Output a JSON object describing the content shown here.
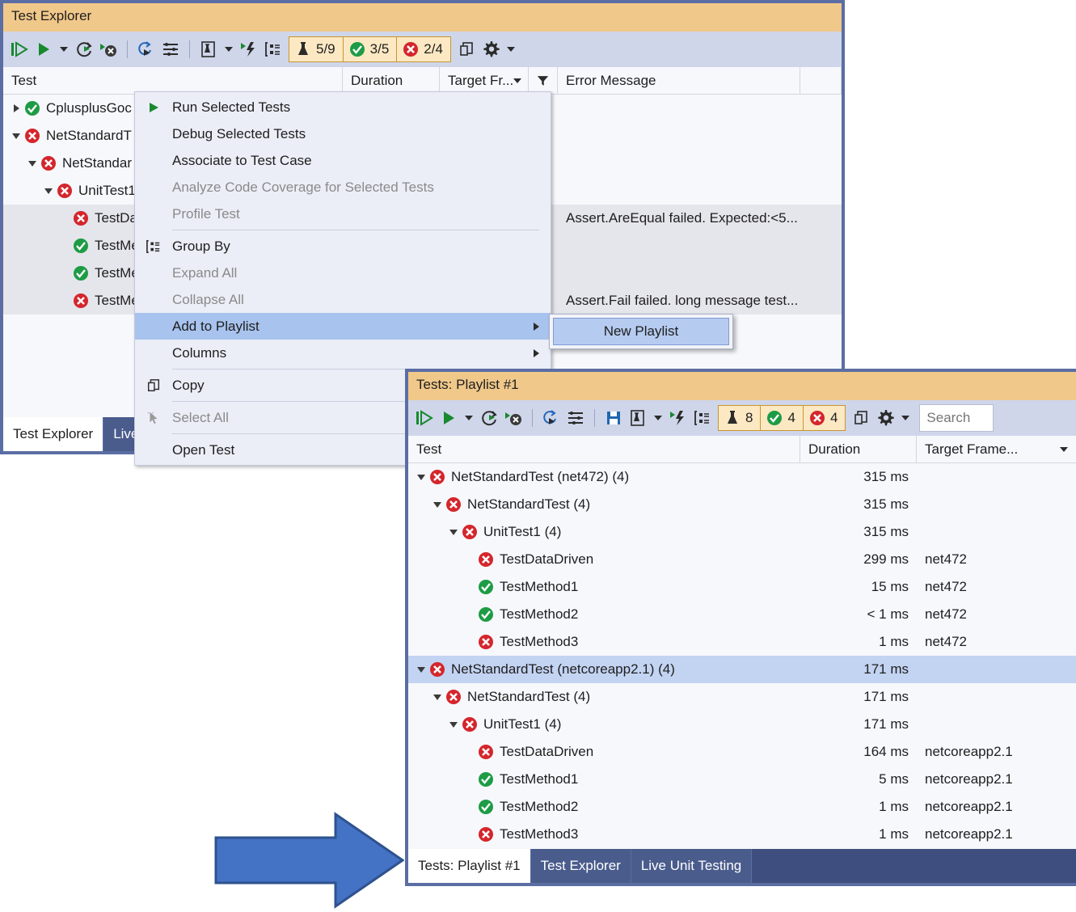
{
  "colors": {
    "window_border": "#5B6EA3",
    "title_bar": "#F0C88A",
    "toolbar": "#CFD6EA",
    "chip_bg": "#FCE8C3",
    "chip_border": "#C9962F",
    "menu_highlight": "#A8C3EE",
    "row_selected_gray": "#E5E5EC",
    "row_selected_blue": "#C3D3F2",
    "tabstrip": "#3E4E7E",
    "arrow_fill": "#4472C4",
    "arrow_stroke": "#2E528F",
    "pass_green": "#1E9C45",
    "fail_red": "#D4262C"
  },
  "explorer": {
    "title": "Test Explorer",
    "toolbar": {
      "icons": [
        {
          "name": "run-all-tests-icon",
          "label": "Run All Tests"
        },
        {
          "name": "run-icon",
          "label": "Run"
        },
        {
          "name": "run-dropdown-caret-icon",
          "label": "Run options"
        },
        {
          "name": "repeat-last-run-icon",
          "label": "Repeat Last Run"
        },
        {
          "name": "cancel-icon",
          "label": "Cancel"
        },
        {
          "name": "playlist-icon",
          "label": "Playlist"
        },
        {
          "name": "group-rows-icon",
          "label": "Group Rows"
        },
        {
          "name": "test-detail-icon",
          "label": "Test Detail Summary"
        },
        {
          "name": "test-detail-dropdown-caret-icon",
          "label": "Options"
        },
        {
          "name": "live-unit-testing-icon",
          "label": "Live Unit Testing"
        },
        {
          "name": "group-by-icon",
          "label": "Group By"
        }
      ],
      "chips": [
        {
          "name": "chip-total",
          "icon": "flask-icon",
          "value": "5/9"
        },
        {
          "name": "chip-passed",
          "icon": "check-circle-icon",
          "value": "3/5"
        },
        {
          "name": "chip-failed",
          "icon": "error-circle-icon",
          "value": "2/4"
        }
      ],
      "trailing_icons": [
        {
          "name": "copy-icon",
          "label": "Copy"
        },
        {
          "name": "gear-icon",
          "label": "Settings"
        },
        {
          "name": "gear-dropdown-caret-icon",
          "label": "Settings options"
        }
      ]
    },
    "columns": [
      {
        "name": "column-test",
        "label": "Test"
      },
      {
        "name": "column-duration",
        "label": "Duration"
      },
      {
        "name": "column-target-framework",
        "label": "Target Fr...",
        "has_sort_caret": true
      },
      {
        "name": "column-filter",
        "label": "",
        "icon": "filter-icon"
      },
      {
        "name": "column-error-message",
        "label": "Error Message"
      }
    ],
    "rows": [
      {
        "indent": 0,
        "expander": "collapsed",
        "status": "pass",
        "label": "CplusplusGoc",
        "error": "",
        "selected": false
      },
      {
        "indent": 0,
        "expander": "expanded",
        "status": "fail",
        "label": "NetStandardT",
        "error": "",
        "selected": false
      },
      {
        "indent": 1,
        "expander": "expanded",
        "status": "fail",
        "label": "NetStandar",
        "error": "",
        "selected": false
      },
      {
        "indent": 2,
        "expander": "expanded",
        "status": "fail",
        "label": "UnitTest1",
        "error": "",
        "selected": false
      },
      {
        "indent": 3,
        "expander": "none",
        "status": "fail",
        "label": "TestData",
        "error": "Assert.AreEqual failed. Expected:<5...",
        "selected": true
      },
      {
        "indent": 3,
        "expander": "none",
        "status": "pass",
        "label": "TestMet",
        "error": "",
        "selected": true
      },
      {
        "indent": 3,
        "expander": "none",
        "status": "pass",
        "label": "TestMet",
        "error": "",
        "selected": true
      },
      {
        "indent": 3,
        "expander": "none",
        "status": "fail",
        "label": "TestMet",
        "error": "Assert.Fail failed. long message test...",
        "selected": true
      }
    ],
    "tabs": [
      {
        "name": "doc-tab-test-explorer",
        "label": "Test Explorer",
        "active": true
      },
      {
        "name": "doc-tab-live-unit-testing",
        "label": "Live",
        "active": false
      }
    ]
  },
  "context_menu": {
    "items": [
      {
        "name": "menu-run-selected-tests",
        "label": "Run Selected Tests",
        "icon": "run-icon",
        "disabled": false,
        "highlighted": false,
        "submenu": false
      },
      {
        "name": "menu-debug-selected-tests",
        "label": "Debug Selected Tests",
        "icon": "",
        "disabled": false,
        "highlighted": false,
        "submenu": false
      },
      {
        "name": "menu-associate-to-test-case",
        "label": "Associate to Test Case",
        "icon": "",
        "disabled": false,
        "highlighted": false,
        "submenu": false
      },
      {
        "name": "menu-analyze-code-coverage",
        "label": "Analyze Code Coverage for Selected Tests",
        "icon": "",
        "disabled": true,
        "highlighted": false,
        "submenu": false
      },
      {
        "name": "menu-profile-test",
        "label": "Profile Test",
        "icon": "",
        "disabled": true,
        "highlighted": false,
        "submenu": false
      },
      {
        "separator": true
      },
      {
        "name": "menu-group-by",
        "label": "Group By",
        "icon": "group-by-icon",
        "disabled": false,
        "highlighted": false,
        "submenu": false
      },
      {
        "name": "menu-expand-all",
        "label": "Expand All",
        "icon": "",
        "disabled": true,
        "highlighted": false,
        "submenu": false
      },
      {
        "name": "menu-collapse-all",
        "label": "Collapse All",
        "icon": "",
        "disabled": true,
        "highlighted": false,
        "submenu": false
      },
      {
        "name": "menu-add-to-playlist",
        "label": "Add to Playlist",
        "icon": "",
        "disabled": false,
        "highlighted": true,
        "submenu": true
      },
      {
        "name": "menu-columns",
        "label": "Columns",
        "icon": "",
        "disabled": false,
        "highlighted": false,
        "submenu": true
      },
      {
        "separator": true
      },
      {
        "name": "menu-copy",
        "label": "Copy",
        "icon": "copy-icon",
        "disabled": false,
        "highlighted": false,
        "submenu": false
      },
      {
        "separator": true
      },
      {
        "name": "menu-select-all",
        "label": "Select All",
        "icon": "select-all-icon",
        "disabled": true,
        "highlighted": false,
        "submenu": false
      },
      {
        "separator": true
      },
      {
        "name": "menu-open-test",
        "label": "Open Test",
        "icon": "",
        "disabled": false,
        "highlighted": false,
        "submenu": false
      }
    ],
    "submenu": {
      "items": [
        {
          "name": "submenu-new-playlist",
          "label": "New Playlist"
        }
      ]
    }
  },
  "playlist": {
    "title": "Tests: Playlist #1",
    "toolbar": {
      "icons": [
        {
          "name": "run-all-tests-icon",
          "label": "Run All Tests"
        },
        {
          "name": "run-icon",
          "label": "Run"
        },
        {
          "name": "run-dropdown-caret-icon",
          "label": "Run options"
        },
        {
          "name": "repeat-last-run-icon",
          "label": "Repeat Last Run"
        },
        {
          "name": "cancel-icon",
          "label": "Cancel"
        },
        {
          "name": "playlist-icon",
          "label": "Playlist"
        },
        {
          "name": "group-rows-icon",
          "label": "Group Rows"
        },
        {
          "name": "save-icon",
          "label": "Save Playlist"
        },
        {
          "name": "test-detail-icon",
          "label": "Test Detail Summary"
        },
        {
          "name": "test-detail-dropdown-caret-icon",
          "label": "Options"
        },
        {
          "name": "live-unit-testing-icon",
          "label": "Live Unit Testing"
        },
        {
          "name": "group-by-icon",
          "label": "Group By"
        }
      ],
      "chips": [
        {
          "name": "chip-total",
          "icon": "flask-icon",
          "value": "8"
        },
        {
          "name": "chip-passed",
          "icon": "check-circle-icon",
          "value": "4"
        },
        {
          "name": "chip-failed",
          "icon": "error-circle-icon",
          "value": "4"
        }
      ],
      "trailing_icons": [
        {
          "name": "copy-icon",
          "label": "Copy"
        },
        {
          "name": "gear-icon",
          "label": "Settings"
        },
        {
          "name": "gear-dropdown-caret-icon",
          "label": "Settings options"
        }
      ],
      "search_placeholder": "Search"
    },
    "columns": [
      {
        "name": "column-test",
        "label": "Test"
      },
      {
        "name": "column-duration",
        "label": "Duration"
      },
      {
        "name": "column-target-framework",
        "label": "Target Frame...",
        "has_sort_caret": true
      }
    ],
    "rows": [
      {
        "indent": 0,
        "expander": "expanded",
        "status": "fail",
        "label": "NetStandardTest (net472) (4)",
        "duration": "315 ms",
        "framework": "",
        "selected": false
      },
      {
        "indent": 1,
        "expander": "expanded",
        "status": "fail",
        "label": "NetStandardTest (4)",
        "duration": "315 ms",
        "framework": "",
        "selected": false
      },
      {
        "indent": 2,
        "expander": "expanded",
        "status": "fail",
        "label": "UnitTest1 (4)",
        "duration": "315 ms",
        "framework": "",
        "selected": false
      },
      {
        "indent": 3,
        "expander": "none",
        "status": "fail",
        "label": "TestDataDriven",
        "duration": "299 ms",
        "framework": "net472",
        "selected": false
      },
      {
        "indent": 3,
        "expander": "none",
        "status": "pass",
        "label": "TestMethod1",
        "duration": "15 ms",
        "framework": "net472",
        "selected": false
      },
      {
        "indent": 3,
        "expander": "none",
        "status": "pass",
        "label": "TestMethod2",
        "duration": "< 1 ms",
        "framework": "net472",
        "selected": false
      },
      {
        "indent": 3,
        "expander": "none",
        "status": "fail",
        "label": "TestMethod3",
        "duration": "1 ms",
        "framework": "net472",
        "selected": false
      },
      {
        "indent": 0,
        "expander": "expanded",
        "status": "fail",
        "label": "NetStandardTest (netcoreapp2.1) (4)",
        "duration": "171 ms",
        "framework": "",
        "selected": true
      },
      {
        "indent": 1,
        "expander": "expanded",
        "status": "fail",
        "label": "NetStandardTest (4)",
        "duration": "171 ms",
        "framework": "",
        "selected": false
      },
      {
        "indent": 2,
        "expander": "expanded",
        "status": "fail",
        "label": "UnitTest1 (4)",
        "duration": "171 ms",
        "framework": "",
        "selected": false
      },
      {
        "indent": 3,
        "expander": "none",
        "status": "fail",
        "label": "TestDataDriven",
        "duration": "164 ms",
        "framework": "netcoreapp2.1",
        "selected": false
      },
      {
        "indent": 3,
        "expander": "none",
        "status": "pass",
        "label": "TestMethod1",
        "duration": "5 ms",
        "framework": "netcoreapp2.1",
        "selected": false
      },
      {
        "indent": 3,
        "expander": "none",
        "status": "pass",
        "label": "TestMethod2",
        "duration": "1 ms",
        "framework": "netcoreapp2.1",
        "selected": false
      },
      {
        "indent": 3,
        "expander": "none",
        "status": "fail",
        "label": "TestMethod3",
        "duration": "1 ms",
        "framework": "netcoreapp2.1",
        "selected": false
      }
    ],
    "tabs": [
      {
        "name": "doc-tab-tests-playlist-1",
        "label": "Tests: Playlist #1",
        "active": true
      },
      {
        "name": "doc-tab-test-explorer",
        "label": "Test Explorer",
        "active": false
      },
      {
        "name": "doc-tab-live-unit-testing",
        "label": "Live Unit Testing",
        "active": false
      }
    ]
  },
  "annotation": {
    "arrow": {
      "name": "callout-arrow",
      "direction": "right"
    }
  }
}
